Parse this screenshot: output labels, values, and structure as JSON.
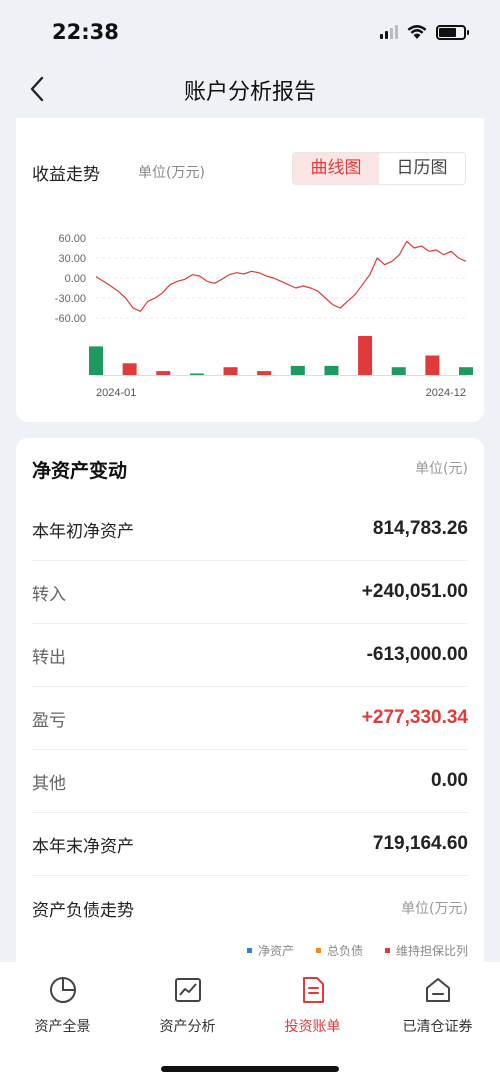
{
  "status": {
    "time": "22:38"
  },
  "nav": {
    "title": "账户分析报告"
  },
  "profit_chart": {
    "title": "收益走势",
    "unit": "单位(万元)",
    "tabs": [
      {
        "label": "曲线图",
        "active": true
      },
      {
        "label": "日历图",
        "active": false
      }
    ]
  },
  "chart_data": {
    "type": "line",
    "ylabel": "",
    "ylim": [
      -60,
      60
    ],
    "y_ticks": [
      "60.00",
      "30.00",
      "0.00",
      "-30.00",
      "-60.00"
    ],
    "x_labels": [
      "2024-01",
      "2024-12"
    ],
    "series": [
      {
        "values": [
          2,
          -5,
          -12,
          -20,
          -30,
          -45,
          -50,
          -35,
          -30,
          -22,
          -10,
          -5,
          -2,
          5,
          3,
          -5,
          -8,
          -2,
          5,
          8,
          6,
          10,
          8,
          3,
          0,
          -5,
          -10,
          -15,
          -12,
          -15,
          -20,
          -30,
          -40,
          -45,
          -35,
          -25,
          -10,
          5,
          30,
          20,
          25,
          35,
          55,
          45,
          48,
          40,
          42,
          35,
          40,
          30,
          25
        ]
      }
    ],
    "bars": {
      "values": [
        22,
        -9,
        -3,
        0.5,
        -6,
        -3,
        7,
        7,
        -30,
        6,
        -15,
        6
      ],
      "colors": [
        "#1f9a5e",
        "#e03b3b",
        "#e03b3b",
        "#1f9a5e",
        "#e03b3b",
        "#e03b3b",
        "#1f9a5e",
        "#1f9a5e",
        "#e03b3b",
        "#1f9a5e",
        "#e03b3b",
        "#1f9a5e"
      ]
    }
  },
  "net_assets": {
    "title": "净资产变动",
    "unit": "单位(元)",
    "rows": [
      {
        "label": "本年初净资产",
        "value": "814,783.26"
      },
      {
        "label": "转入",
        "value": "+240,051.00"
      },
      {
        "label": "转出",
        "value": "-613,000.00"
      },
      {
        "label": "盈亏",
        "value": "+277,330.34"
      },
      {
        "label": "其他",
        "value": "0.00"
      },
      {
        "label": "本年末净资产",
        "value": "719,164.60"
      }
    ]
  },
  "debt_trend": {
    "title": "资产负债走势",
    "unit": "单位(万元)",
    "legend": [
      {
        "label": "净资产",
        "color": "#2f7fd6"
      },
      {
        "label": "总负债",
        "color": "#f08a24"
      },
      {
        "label": "维持担保比列",
        "color": "#e03b3b"
      }
    ]
  },
  "tabbar": {
    "items": [
      {
        "label": "资产全景",
        "icon": "pie-chart-icon"
      },
      {
        "label": "资产分析",
        "icon": "trend-chart-icon"
      },
      {
        "label": "投资账单",
        "icon": "bill-icon",
        "active": true
      },
      {
        "label": "已清仓证券",
        "icon": "cleared-house-icon"
      }
    ]
  },
  "colors": {
    "accent": "#e03b3b",
    "up": "#e03b3b",
    "down": "#1f9a5e"
  }
}
